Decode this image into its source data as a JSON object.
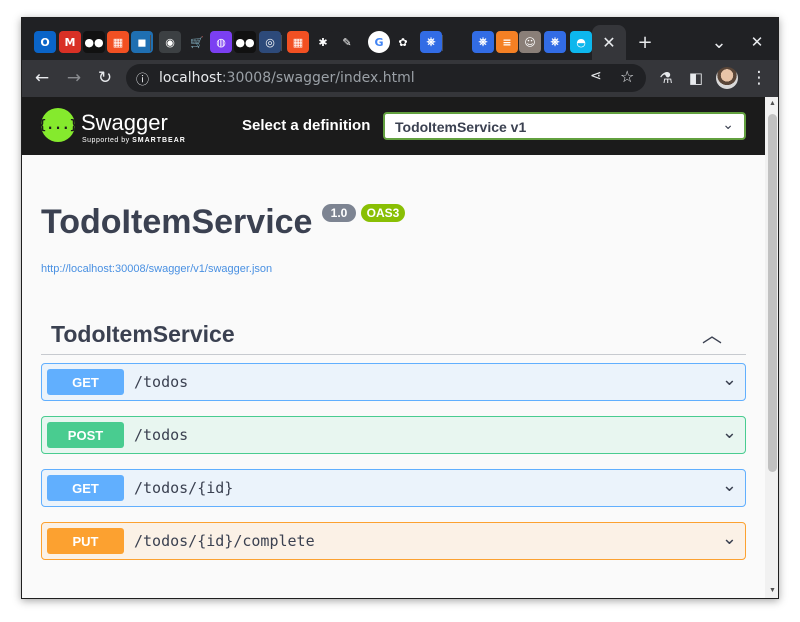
{
  "browser": {
    "tabs": [
      {
        "icon": "outlook-icon",
        "glyph": "O",
        "color": "#0a64c8"
      },
      {
        "icon": "gmail-icon",
        "glyph": "M",
        "color": "#d93025"
      },
      {
        "icon": "medium-icon",
        "glyph": "●●",
        "color": "#111111"
      },
      {
        "icon": "microsoft-icon",
        "glyph": "▦",
        "color": "#f25022"
      },
      {
        "icon": "app-blue-icon",
        "glyph": "◼",
        "color": "#1f6fb2"
      },
      {
        "icon": "camera-icon",
        "glyph": "◉",
        "color": "#3c4043"
      },
      {
        "icon": "cart-icon",
        "glyph": "🛒",
        "color": "#202124"
      },
      {
        "icon": "messenger-icon",
        "glyph": "◍",
        "color": "#7b3ff2"
      },
      {
        "icon": "medium-icon-2",
        "glyph": "●●",
        "color": "#111111"
      },
      {
        "icon": "circle-icon",
        "glyph": "◎",
        "color": "#2d4a7a"
      },
      {
        "icon": "microsoft-icon-2",
        "glyph": "▦",
        "color": "#f25022"
      },
      {
        "icon": "asterisk-icon",
        "glyph": "✱",
        "color": "#202124"
      },
      {
        "icon": "pencil-icon",
        "glyph": "✎",
        "color": "#202124"
      },
      {
        "icon": "google-icon",
        "glyph": "G",
        "color": "#ffffff"
      },
      {
        "icon": "bot-icon",
        "glyph": "✿",
        "color": "#202124"
      },
      {
        "icon": "kubernetes-icon",
        "glyph": "⎈",
        "color": "#326ce5"
      },
      {
        "icon": "blank-icon",
        "glyph": "",
        "color": "#202124"
      },
      {
        "icon": "kubernetes-icon-2",
        "glyph": "⎈",
        "color": "#326ce5"
      },
      {
        "icon": "stackoverflow-icon",
        "glyph": "≡",
        "color": "#f48024"
      },
      {
        "icon": "profile-photo-icon",
        "glyph": "☺",
        "color": "#8a7f78"
      },
      {
        "icon": "kubernetes-icon-3",
        "glyph": "⎈",
        "color": "#326ce5"
      },
      {
        "icon": "docker-icon",
        "glyph": "◓",
        "color": "#0db7ed"
      }
    ],
    "active_tab_close": "✕",
    "new_tab": "+",
    "tab_search": "⌄",
    "window_close": "✕",
    "url_host": "localhost",
    "url_rest": ":30008/swagger/index.html"
  },
  "swagger": {
    "logo_glyph": "{...}",
    "brand": "Swagger",
    "supported_by": "Supported by",
    "smartbear": "SMARTBEAR",
    "definition_label": "Select a definition",
    "definition_value": "TodoItemService v1",
    "title": "TodoItemService",
    "version_badge": "1.0",
    "oas_badge": "OAS3",
    "spec_url": "http://localhost:30008/swagger/v1/swagger.json",
    "tag": "TodoItemService",
    "operations": [
      {
        "method": "GET",
        "path": "/todos"
      },
      {
        "method": "POST",
        "path": "/todos"
      },
      {
        "method": "GET",
        "path": "/todos/{id}"
      },
      {
        "method": "PUT",
        "path": "/todos/{id}/complete"
      }
    ]
  },
  "colors": {
    "get": "#61affe",
    "post": "#49cc90",
    "put": "#fca130",
    "swagger_green": "#85ea2d"
  }
}
